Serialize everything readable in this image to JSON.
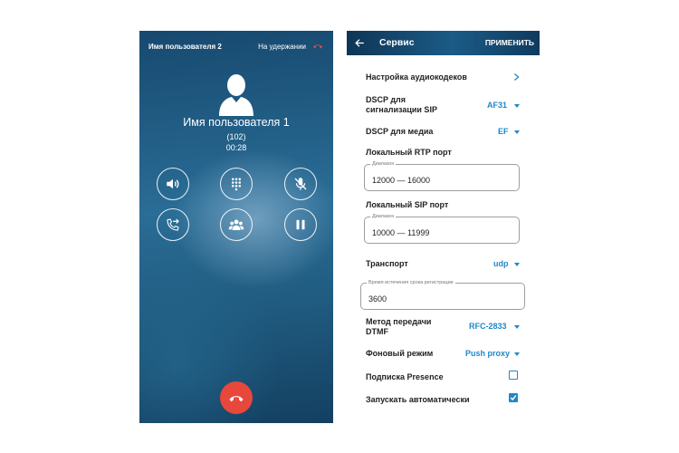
{
  "call": {
    "held_user": "Имя пользователя 2",
    "hold_status": "На удержании",
    "caller_name": "Имя пользователя 1",
    "caller_number": "(102)",
    "timer": "00:28"
  },
  "settings": {
    "title": "Сервис",
    "apply_label": "ПРИМЕНИТЬ",
    "codecs_label": "Настройка аудиокодеков",
    "dscp_sip_label_line1": "DSCP для",
    "dscp_sip_label_line2": "сигнализации SIP",
    "dscp_sip_value": "AF31",
    "dscp_media_label": "DSCP для медиа",
    "dscp_media_value": "EF",
    "rtp_label": "Локальный RTP порт",
    "rtp_hint": "Диапазон",
    "rtp_value": "12000 — 16000",
    "sip_label": "Локальный SIP порт",
    "sip_hint": "Диапазон",
    "sip_value": "10000 — 11999",
    "transport_label": "Транспорт",
    "transport_value": "udp",
    "reg_hint": "Время истечения срока регистрации",
    "reg_value": "3600",
    "dtmf_label_line1": "Метод передачи",
    "dtmf_label_line2": "DTMF",
    "dtmf_value": "RFC-2833",
    "background_label": "Фоновый режим",
    "background_value": "Push proxy",
    "presence_label": "Подписка Presence",
    "presence_checked": false,
    "autostart_label": "Запускать автоматически",
    "autostart_checked": true
  },
  "colors": {
    "accent": "#1e88c8",
    "end_call": "#e8473b",
    "app_bar": "#0e3556"
  }
}
